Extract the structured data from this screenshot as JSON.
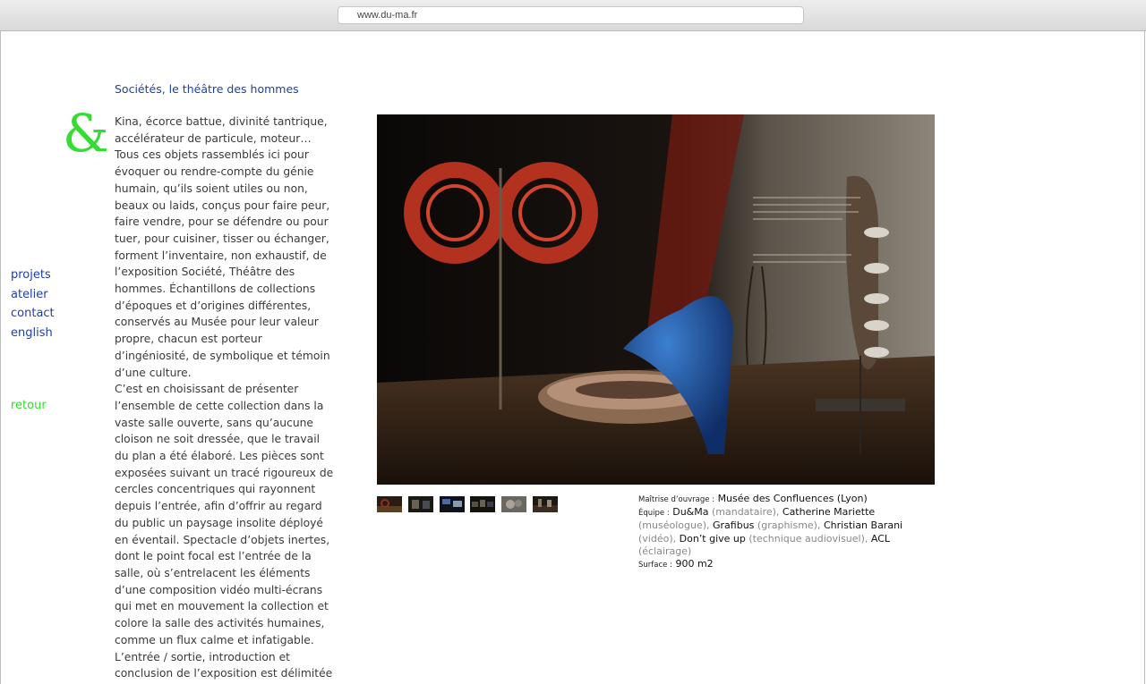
{
  "browser": {
    "url": "www.du-ma.fr"
  },
  "logo": {
    "symbol": "&",
    "color": "#33dd33"
  },
  "nav": {
    "items": [
      "projets",
      "atelier",
      "contact",
      "english"
    ],
    "back_label": "retour"
  },
  "project": {
    "title": "Sociétés, le théâtre des hommes",
    "paragraphs": [
      "Kina, écorce battue, divinité tantrique, accélérateur de particule, moteur… Tous ces objets rassemblés ici pour évoquer ou rendre-compte du génie humain, qu’ils soient utiles ou non, beaux ou laids, conçus pour faire peur, faire vendre, pour se défendre ou pour tuer, pour cuisiner, tisser ou échanger, forment l’inventaire, non exhaustif, de l’exposition Société, Théâtre des hommes. Échantillons de collections d’époques et d’origines différentes, conservés au Musée pour leur valeur propre, chacun est porteur d’ingéniosité, de symbolique et témoin d’une culture.",
      "C’est en choisissant de présenter l’ensemble de cette collection dans la vaste salle ouverte, sans qu’aucune cloison ne soit dressée, que le travail du plan a été élaboré. Les pièces sont exposées suivant un tracé rigoureux de cercles concentriques qui rayonnent depuis l’entrée, afin d’offrir au regard du public un paysage insolite déployé en éventail. Spectacle d’objets inertes, dont le point focal est l’entrée de la salle, où s’entrelacent les éléments d’une composition vidéo multi-écrans qui met en mouvement la collection et colore la salle des activités humaines, comme un flux calme et infatigable. L’entrée / sortie, introduction et conclusion de l’exposition est délimitée"
    ]
  },
  "gallery": {
    "thumbnail_count": 6
  },
  "credits": {
    "client_label": "Maîtrise d’ouvrage :",
    "client": "Musée des Confluences (Lyon)",
    "team_label": "Équipe :",
    "team": [
      {
        "name": "Du&Ma",
        "role": "(mandataire)",
        "sep": ", "
      },
      {
        "name": "Catherine Mariette",
        "role": "(muséologue)",
        "sep": ", "
      },
      {
        "name": "Grafibus",
        "role": "(graphisme)",
        "sep": ", "
      },
      {
        "name": "Christian Barani",
        "role": "(vidéo)",
        "sep": ", "
      },
      {
        "name": "Don’t give up",
        "role": "(technique audiovisuel)",
        "sep": ", "
      },
      {
        "name": "ACL",
        "role": "(éclairage)",
        "sep": ""
      }
    ],
    "surface_label": "Surface :",
    "surface": "900 m2"
  },
  "colors": {
    "link": "#1f3fa8",
    "accent": "#33dd33"
  }
}
